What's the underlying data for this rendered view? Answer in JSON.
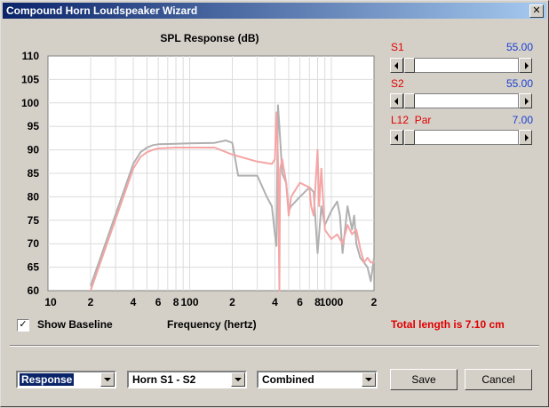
{
  "window": {
    "title": "Compound Horn Loudspeaker Wizard"
  },
  "sliders": [
    {
      "label": "S1",
      "value": "55.00",
      "position": 0.06
    },
    {
      "label": "S2",
      "value": "55.00",
      "position": 0.06
    },
    {
      "label": "L12  Par",
      "value": "7.00",
      "position": 0.06
    }
  ],
  "show_baseline": {
    "label": "Show Baseline",
    "checked": true
  },
  "total_length": "Total length is 7.10 cm",
  "dropdowns": [
    {
      "value": "Response"
    },
    {
      "value": "Horn S1 - S2"
    },
    {
      "value": "Combined"
    }
  ],
  "buttons": {
    "save": "Save",
    "cancel": "Cancel"
  },
  "colors": {
    "baseline": "#b0b0b0",
    "response": "#f5a5a5",
    "accent_red": "#e00000",
    "accent_blue": "#1a3fd0"
  },
  "chart_data": {
    "type": "line",
    "title": "SPL Response (dB)",
    "xlabel": "Frequency (hertz)",
    "ylabel": "",
    "x_scale": "log",
    "xlim": [
      10,
      2000
    ],
    "ylim": [
      60,
      110
    ],
    "yticks": [
      60,
      65,
      70,
      75,
      80,
      85,
      90,
      95,
      100,
      105,
      110
    ],
    "xtick_labels": [
      "10",
      "2",
      "4",
      "6",
      "8",
      "100",
      "2",
      "4",
      "6",
      "8",
      "1000",
      "2"
    ],
    "xtick_values": [
      10,
      20,
      40,
      60,
      80,
      100,
      200,
      400,
      600,
      800,
      1000,
      2000
    ],
    "grid": true,
    "series": [
      {
        "color": "#b0b0b0",
        "x": [
          20,
          40,
          45,
          50,
          55,
          60,
          80,
          100,
          150,
          180,
          200,
          220,
          300,
          350,
          380,
          400,
          410,
          420,
          430,
          450,
          480,
          500,
          520,
          600,
          700,
          750,
          800,
          850,
          900,
          1000,
          1100,
          1150,
          1200,
          1300,
          1400,
          1450,
          1500,
          1600,
          1700,
          1800,
          1900,
          2000
        ],
        "y": [
          61,
          87,
          89.5,
          90.5,
          91,
          91.2,
          91.3,
          91.4,
          91.5,
          92,
          91.5,
          84.5,
          84.5,
          80,
          78,
          72,
          69.5,
          99.5,
          95,
          85,
          83,
          77,
          78,
          80,
          82,
          81,
          68,
          78,
          74,
          77,
          79,
          76,
          68,
          78,
          73,
          76,
          70,
          67,
          66,
          65,
          62,
          67
        ]
      },
      {
        "color": "#f5a5a5",
        "x": [
          20,
          40,
          45,
          50,
          55,
          60,
          80,
          100,
          150,
          200,
          300,
          380,
          400,
          410,
          420,
          430,
          435,
          450,
          480,
          500,
          520,
          600,
          700,
          720,
          750,
          800,
          820,
          850,
          900,
          1000,
          1100,
          1200,
          1300,
          1400,
          1500,
          1600,
          1700,
          1800,
          1900,
          2000
        ],
        "y": [
          60,
          86,
          88.5,
          89.5,
          90,
          90.3,
          90.5,
          90.5,
          90.5,
          89,
          87.5,
          87,
          88,
          98,
          88,
          60,
          86,
          88,
          83,
          76,
          80,
          83,
          82,
          78,
          76,
          90,
          78,
          86,
          73,
          71,
          72,
          70,
          74,
          72,
          73,
          69,
          66,
          67,
          66,
          66
        ]
      }
    ]
  }
}
